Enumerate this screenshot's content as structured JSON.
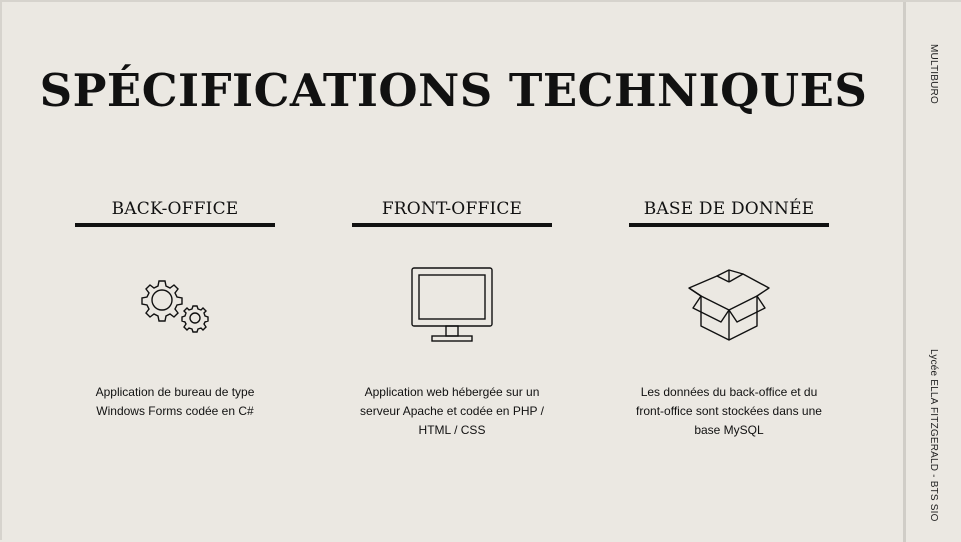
{
  "slide": {
    "title": "SPÉCIFICATIONS TECHNIQUES",
    "side_top": "MULTIBURO",
    "side_bottom": "Lycée ELLA FITZGERALD - BTS SIO"
  },
  "columns": [
    {
      "heading": "BACK-OFFICE",
      "icon": "gears-icon",
      "description": "Application de bureau de type Windows Forms codée en C#"
    },
    {
      "heading": "FRONT-OFFICE",
      "icon": "monitor-icon",
      "description": "Application web hébergée sur un serveur Apache et codée en PHP / HTML / CSS"
    },
    {
      "heading": "BASE DE DONNÉE",
      "icon": "open-box-icon",
      "description": "Les données du back-office et du front-office sont stockées dans une base MySQL"
    }
  ]
}
